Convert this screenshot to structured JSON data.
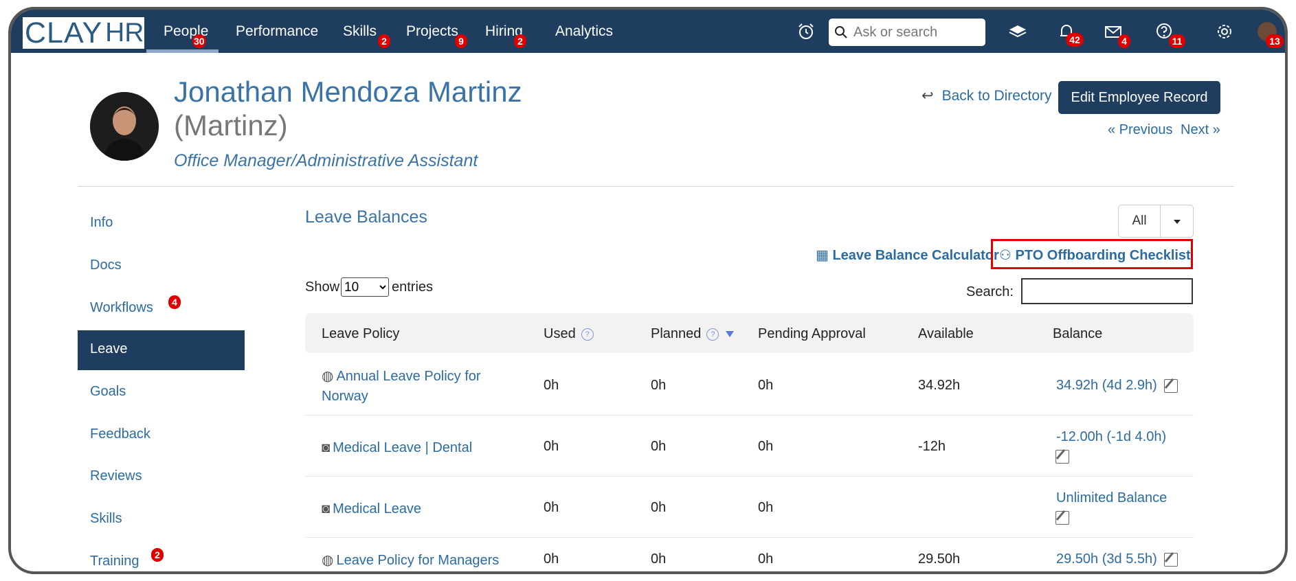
{
  "app": {
    "logo_clay": "CLAY",
    "logo_hr": "HR"
  },
  "nav": {
    "items": [
      {
        "label": "People",
        "badge": "30"
      },
      {
        "label": "Performance",
        "badge": ""
      },
      {
        "label": "Skills",
        "badge": "2"
      },
      {
        "label": "Projects",
        "badge": "9"
      },
      {
        "label": "Hiring",
        "badge": "2"
      },
      {
        "label": "Analytics",
        "badge": ""
      }
    ],
    "search_placeholder": "Ask or search",
    "notifications_badge": "42",
    "messages_badge": "4",
    "help_badge": "11",
    "avatar_badge": "13"
  },
  "employee": {
    "name": "Jonathan Mendoza Martinz",
    "nickname": "(Martinz)",
    "title": "Office Manager/Administrative Assistant"
  },
  "actions": {
    "back": "Back to Directory",
    "edit": "Edit Employee Record",
    "previous": "« Previous",
    "next": "Next »"
  },
  "sidebar": {
    "items": [
      {
        "label": "Info",
        "badge": ""
      },
      {
        "label": "Docs",
        "badge": ""
      },
      {
        "label": "Workflows",
        "badge": "4"
      },
      {
        "label": "Leave",
        "badge": "",
        "active": true
      },
      {
        "label": "Goals",
        "badge": ""
      },
      {
        "label": "Feedback",
        "badge": ""
      },
      {
        "label": "Reviews",
        "badge": ""
      },
      {
        "label": "Skills",
        "badge": ""
      },
      {
        "label": "Training",
        "badge": "2"
      }
    ]
  },
  "leave": {
    "title": "Leave Balances",
    "filter": "All",
    "calculator_link": "Leave Balance Calculator",
    "checklist_link": "PTO Offboarding Checklist",
    "show_label": "Show",
    "entries_value": "10",
    "entries_label": "entries",
    "search_label": "Search:",
    "columns": [
      "Leave Policy",
      "Used",
      "Planned",
      "Pending Approval",
      "Available",
      "Balance"
    ],
    "rows": [
      {
        "policy_line1": "Annual Leave Policy for",
        "policy_line2": "Norway",
        "used": "0h",
        "planned": "0h",
        "pending": "0h",
        "available": "34.92h",
        "balance": "34.92h (4d 2.9h)"
      },
      {
        "policy_line1": "Medical Leave | Dental",
        "policy_line2": "",
        "used": "0h",
        "planned": "0h",
        "pending": "0h",
        "available": "-12h",
        "balance": "-12.00h (-1d 4.0h)"
      },
      {
        "policy_line1": "Medical Leave",
        "policy_line2": "",
        "used": "0h",
        "planned": "0h",
        "pending": "0h",
        "available": "",
        "balance": "Unlimited Balance"
      },
      {
        "policy_line1": "Leave Policy for Managers",
        "policy_line2": "",
        "used": "0h",
        "planned": "0h",
        "pending": "0h",
        "available": "29.50h",
        "balance": "29.50h (3d 5.5h)"
      }
    ]
  }
}
